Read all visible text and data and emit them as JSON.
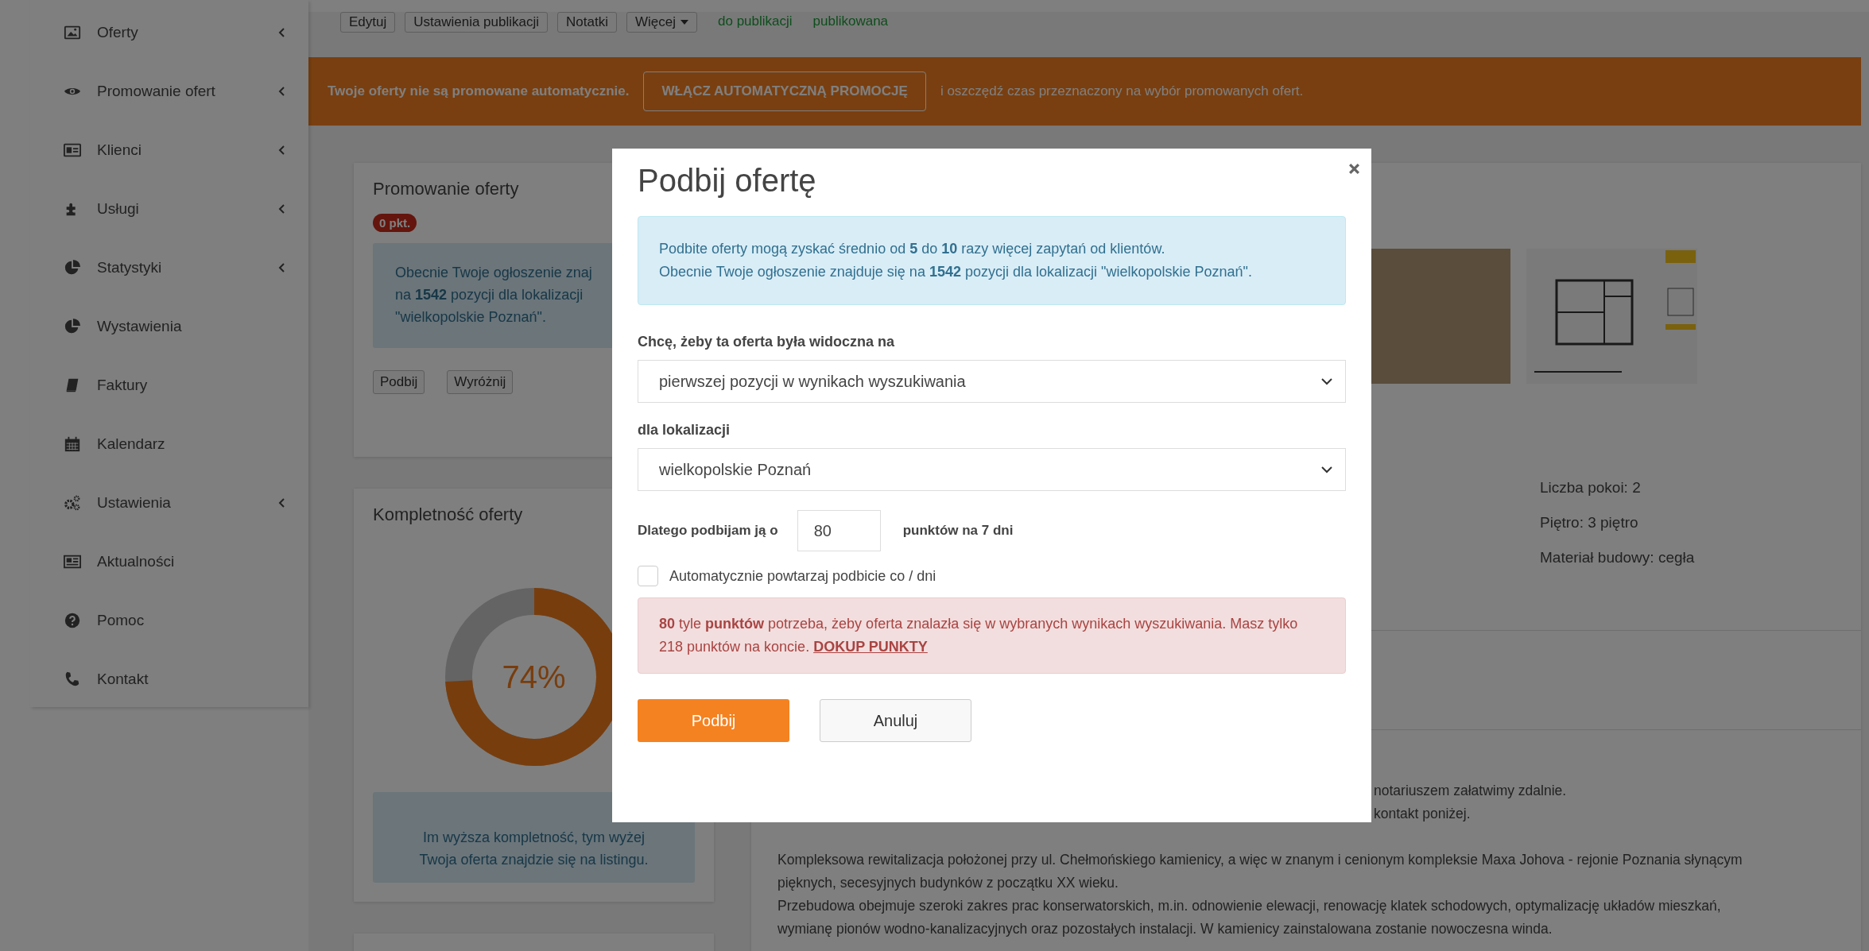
{
  "sidebar": {
    "items": [
      {
        "label": "Oferty",
        "expandable": true
      },
      {
        "label": "Promowanie ofert",
        "expandable": true
      },
      {
        "label": "Klienci",
        "expandable": true
      },
      {
        "label": "Usługi",
        "expandable": true
      },
      {
        "label": "Statystyki",
        "expandable": true
      },
      {
        "label": "Wystawienia",
        "expandable": false
      },
      {
        "label": "Faktury",
        "expandable": false
      },
      {
        "label": "Kalendarz",
        "expandable": false
      },
      {
        "label": "Ustawienia",
        "expandable": true
      },
      {
        "label": "Aktualności",
        "expandable": false
      },
      {
        "label": "Pomoc",
        "expandable": false
      },
      {
        "label": "Kontakt",
        "expandable": false
      }
    ]
  },
  "toolbar": {
    "buttons": [
      {
        "label": "Edytuj",
        "kind": "plain"
      },
      {
        "label": "Ustawienia publikacji",
        "kind": "plain"
      },
      {
        "label": "Notatki",
        "kind": "plain"
      },
      {
        "label": "Więcej",
        "kind": "dropdown"
      }
    ],
    "status_links": [
      "do publikacji",
      "publikowana"
    ]
  },
  "banner": {
    "text": "Twoje oferty nie są promowane automatycznie.",
    "button": "WŁĄCZ AUTOMATYCZNĄ PROMOCJĘ",
    "note": "i oszczędź czas przeznaczony na wybór promowanych ofert."
  },
  "promotion_card": {
    "title": "Promowanie oferty",
    "points_badge": "0 pkt.",
    "info_lines": [
      "Obecnie Twoje ogłoszenie znaj",
      "na **1542** pozycji dla lokalizacji",
      "\"wielkopolskie Poznań\"."
    ],
    "buttons": [
      "Podbij",
      "Wyróżnij"
    ]
  },
  "completeness_card": {
    "title": "Kompletność oferty",
    "level": 0.74,
    "percent": "74%",
    "info_lines": [
      "Im wyższa kompletność, tym wyżej",
      "Twoja oferta znajdzie się na listingu."
    ]
  },
  "details": {
    "specs": [
      "Liczba pokoi: 2",
      "Piętro: 3 piętro",
      "Materiał budowy: cegła"
    ],
    "description": [
      {
        "text": "notariuszem załatwimy zdalnie.",
        "kind": "fragment"
      },
      {
        "text": "kontakt poniżej.",
        "kind": "fragment"
      },
      {
        "text": "Kompleksowa rewitalizacja położonej przy ul. Chełmońskiego kamienicy, a więc w znanym i cenionym kompleksie Maxa Johova - rejonie Poznania słynącym",
        "kind": "paragraph_start"
      },
      {
        "text": "pięknych, secesyjnych budynków z początku XX wieku.",
        "kind": "line"
      },
      {
        "text": "Przebudowa obejmuje szeroki zakres prac konserwatorskich, m.in. odnowienie elewacji, renowację klatek schodowych, optymalizację układów mieszkań,",
        "kind": "line"
      },
      {
        "text": "wymianę pionów wodno-kanalizacyjnych oraz pozostałych instalacji. W kamienicy zainstalowana zostanie nowoczesna winda.",
        "kind": "line"
      }
    ]
  },
  "modal": {
    "title": "Podbij ofertę",
    "info_lines": [
      "Podbite oferty mogą zyskać średnio od **5** do **10** razy więcej zapytań od klientów.",
      "Obecnie Twoje ogłoszenie znajduje się na **1542** pozycji dla lokalizacji \"wielkopolskie Poznań\"."
    ],
    "position_label": "Chcę, żeby ta oferta była widoczna na",
    "position_value": "pierwszej pozycji w wynikach wyszukiwania",
    "location_label": "dla lokalizacji",
    "location_value": "wielkopolskie Poznań",
    "points_label": "Dlatego podbijam ją o",
    "points_value": "80",
    "points_suffix": "punktów na 7 dni",
    "repeat": {
      "label": "Automatycznie powtarzaj podbicie co / dni",
      "checked": false
    },
    "alert": {
      "text": "**80** tyle **punktów** potrzeba, żeby oferta znalazła się w wybranych wynikach wyszukiwania. Masz tylko 218 punktów na koncie.",
      "link": "DOKUP PUNKTY"
    },
    "buttons": [
      {
        "label": "Podbij",
        "kind": "primary"
      },
      {
        "label": "Anuluj",
        "kind": "secondary"
      }
    ]
  }
}
